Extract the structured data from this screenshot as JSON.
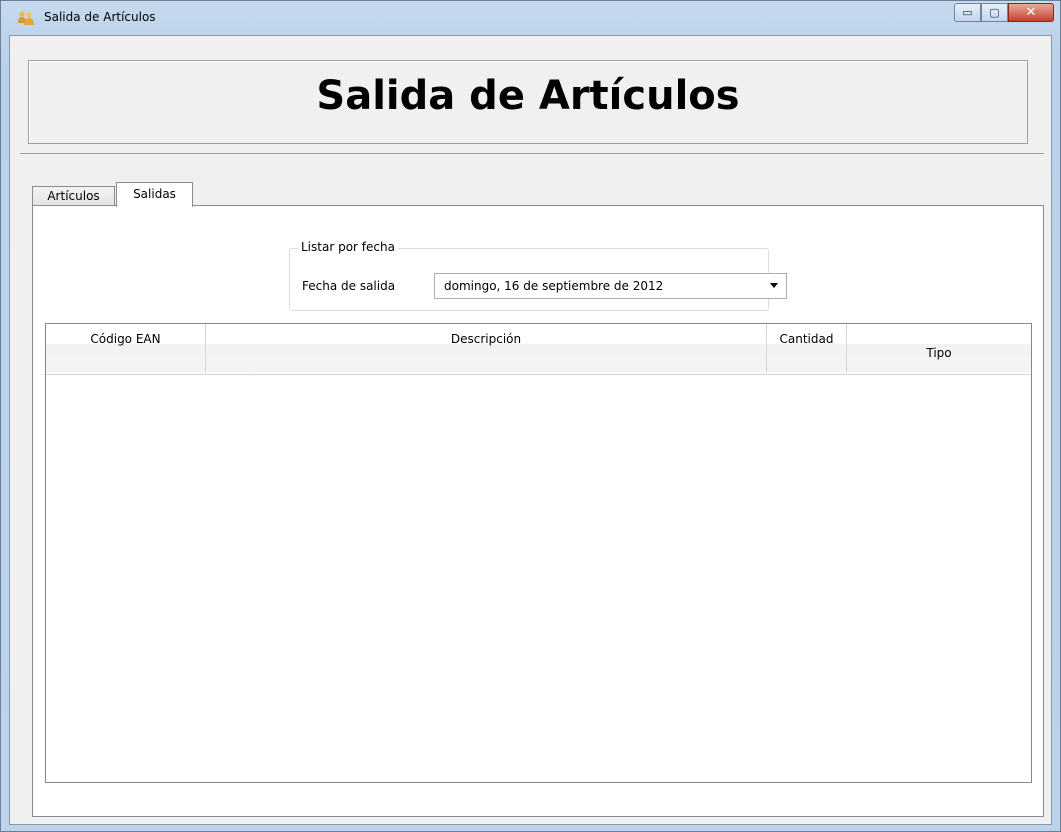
{
  "window": {
    "title": "Salida de Artículos",
    "minimize_glyph": "▭",
    "maximize_glyph": "▢",
    "close_glyph": "✕"
  },
  "header": {
    "title": "Salida de Artículos"
  },
  "tabs": [
    {
      "label": "Artículos",
      "selected": false
    },
    {
      "label": "Salidas",
      "selected": true
    }
  ],
  "filter": {
    "group_label": "Listar por fecha",
    "date_label": "Fecha de salida",
    "date_value": "domingo, 16 de septiembre de 2012"
  },
  "grid": {
    "columns": [
      "Código EAN",
      "Descripción",
      "Cantidad",
      "Tipo"
    ],
    "rows": []
  },
  "colors": {
    "frame": "#b9d1ea",
    "client": "#f0f0f0",
    "close_button": "#c4422c"
  },
  "icons": {
    "app": "users-icon",
    "minimize": "minimize-icon",
    "maximize": "maximize-icon",
    "close": "close-icon",
    "dropdown": "chevron-down-icon"
  }
}
